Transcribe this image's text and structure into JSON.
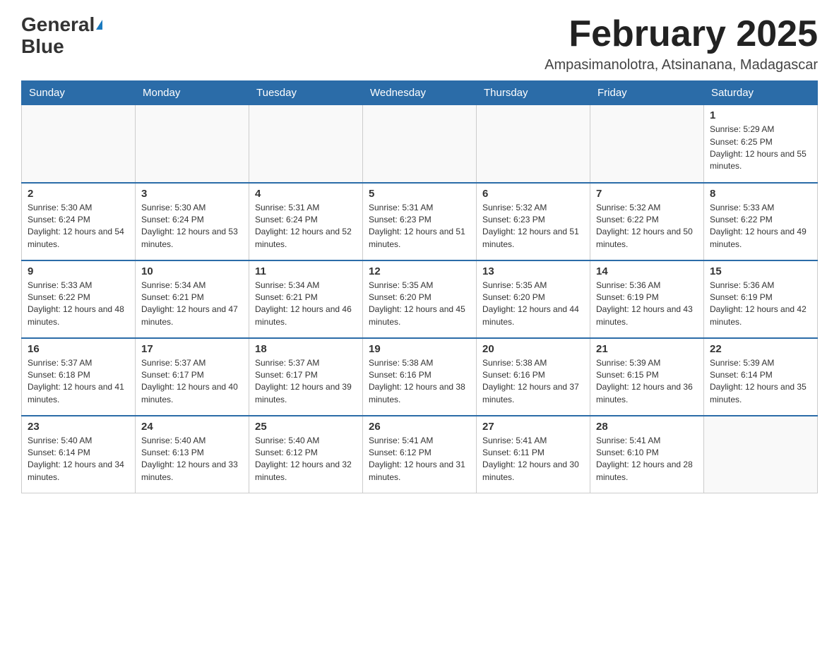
{
  "header": {
    "logo_general": "General",
    "logo_blue": "Blue",
    "month_title": "February 2025",
    "location": "Ampasimanolotra, Atsinanana, Madagascar"
  },
  "weekdays": [
    "Sunday",
    "Monday",
    "Tuesday",
    "Wednesday",
    "Thursday",
    "Friday",
    "Saturday"
  ],
  "weeks": [
    [
      {
        "day": "",
        "info": ""
      },
      {
        "day": "",
        "info": ""
      },
      {
        "day": "",
        "info": ""
      },
      {
        "day": "",
        "info": ""
      },
      {
        "day": "",
        "info": ""
      },
      {
        "day": "",
        "info": ""
      },
      {
        "day": "1",
        "info": "Sunrise: 5:29 AM\nSunset: 6:25 PM\nDaylight: 12 hours and 55 minutes."
      }
    ],
    [
      {
        "day": "2",
        "info": "Sunrise: 5:30 AM\nSunset: 6:24 PM\nDaylight: 12 hours and 54 minutes."
      },
      {
        "day": "3",
        "info": "Sunrise: 5:30 AM\nSunset: 6:24 PM\nDaylight: 12 hours and 53 minutes."
      },
      {
        "day": "4",
        "info": "Sunrise: 5:31 AM\nSunset: 6:24 PM\nDaylight: 12 hours and 52 minutes."
      },
      {
        "day": "5",
        "info": "Sunrise: 5:31 AM\nSunset: 6:23 PM\nDaylight: 12 hours and 51 minutes."
      },
      {
        "day": "6",
        "info": "Sunrise: 5:32 AM\nSunset: 6:23 PM\nDaylight: 12 hours and 51 minutes."
      },
      {
        "day": "7",
        "info": "Sunrise: 5:32 AM\nSunset: 6:22 PM\nDaylight: 12 hours and 50 minutes."
      },
      {
        "day": "8",
        "info": "Sunrise: 5:33 AM\nSunset: 6:22 PM\nDaylight: 12 hours and 49 minutes."
      }
    ],
    [
      {
        "day": "9",
        "info": "Sunrise: 5:33 AM\nSunset: 6:22 PM\nDaylight: 12 hours and 48 minutes."
      },
      {
        "day": "10",
        "info": "Sunrise: 5:34 AM\nSunset: 6:21 PM\nDaylight: 12 hours and 47 minutes."
      },
      {
        "day": "11",
        "info": "Sunrise: 5:34 AM\nSunset: 6:21 PM\nDaylight: 12 hours and 46 minutes."
      },
      {
        "day": "12",
        "info": "Sunrise: 5:35 AM\nSunset: 6:20 PM\nDaylight: 12 hours and 45 minutes."
      },
      {
        "day": "13",
        "info": "Sunrise: 5:35 AM\nSunset: 6:20 PM\nDaylight: 12 hours and 44 minutes."
      },
      {
        "day": "14",
        "info": "Sunrise: 5:36 AM\nSunset: 6:19 PM\nDaylight: 12 hours and 43 minutes."
      },
      {
        "day": "15",
        "info": "Sunrise: 5:36 AM\nSunset: 6:19 PM\nDaylight: 12 hours and 42 minutes."
      }
    ],
    [
      {
        "day": "16",
        "info": "Sunrise: 5:37 AM\nSunset: 6:18 PM\nDaylight: 12 hours and 41 minutes."
      },
      {
        "day": "17",
        "info": "Sunrise: 5:37 AM\nSunset: 6:17 PM\nDaylight: 12 hours and 40 minutes."
      },
      {
        "day": "18",
        "info": "Sunrise: 5:37 AM\nSunset: 6:17 PM\nDaylight: 12 hours and 39 minutes."
      },
      {
        "day": "19",
        "info": "Sunrise: 5:38 AM\nSunset: 6:16 PM\nDaylight: 12 hours and 38 minutes."
      },
      {
        "day": "20",
        "info": "Sunrise: 5:38 AM\nSunset: 6:16 PM\nDaylight: 12 hours and 37 minutes."
      },
      {
        "day": "21",
        "info": "Sunrise: 5:39 AM\nSunset: 6:15 PM\nDaylight: 12 hours and 36 minutes."
      },
      {
        "day": "22",
        "info": "Sunrise: 5:39 AM\nSunset: 6:14 PM\nDaylight: 12 hours and 35 minutes."
      }
    ],
    [
      {
        "day": "23",
        "info": "Sunrise: 5:40 AM\nSunset: 6:14 PM\nDaylight: 12 hours and 34 minutes."
      },
      {
        "day": "24",
        "info": "Sunrise: 5:40 AM\nSunset: 6:13 PM\nDaylight: 12 hours and 33 minutes."
      },
      {
        "day": "25",
        "info": "Sunrise: 5:40 AM\nSunset: 6:12 PM\nDaylight: 12 hours and 32 minutes."
      },
      {
        "day": "26",
        "info": "Sunrise: 5:41 AM\nSunset: 6:12 PM\nDaylight: 12 hours and 31 minutes."
      },
      {
        "day": "27",
        "info": "Sunrise: 5:41 AM\nSunset: 6:11 PM\nDaylight: 12 hours and 30 minutes."
      },
      {
        "day": "28",
        "info": "Sunrise: 5:41 AM\nSunset: 6:10 PM\nDaylight: 12 hours and 28 minutes."
      },
      {
        "day": "",
        "info": ""
      }
    ]
  ]
}
